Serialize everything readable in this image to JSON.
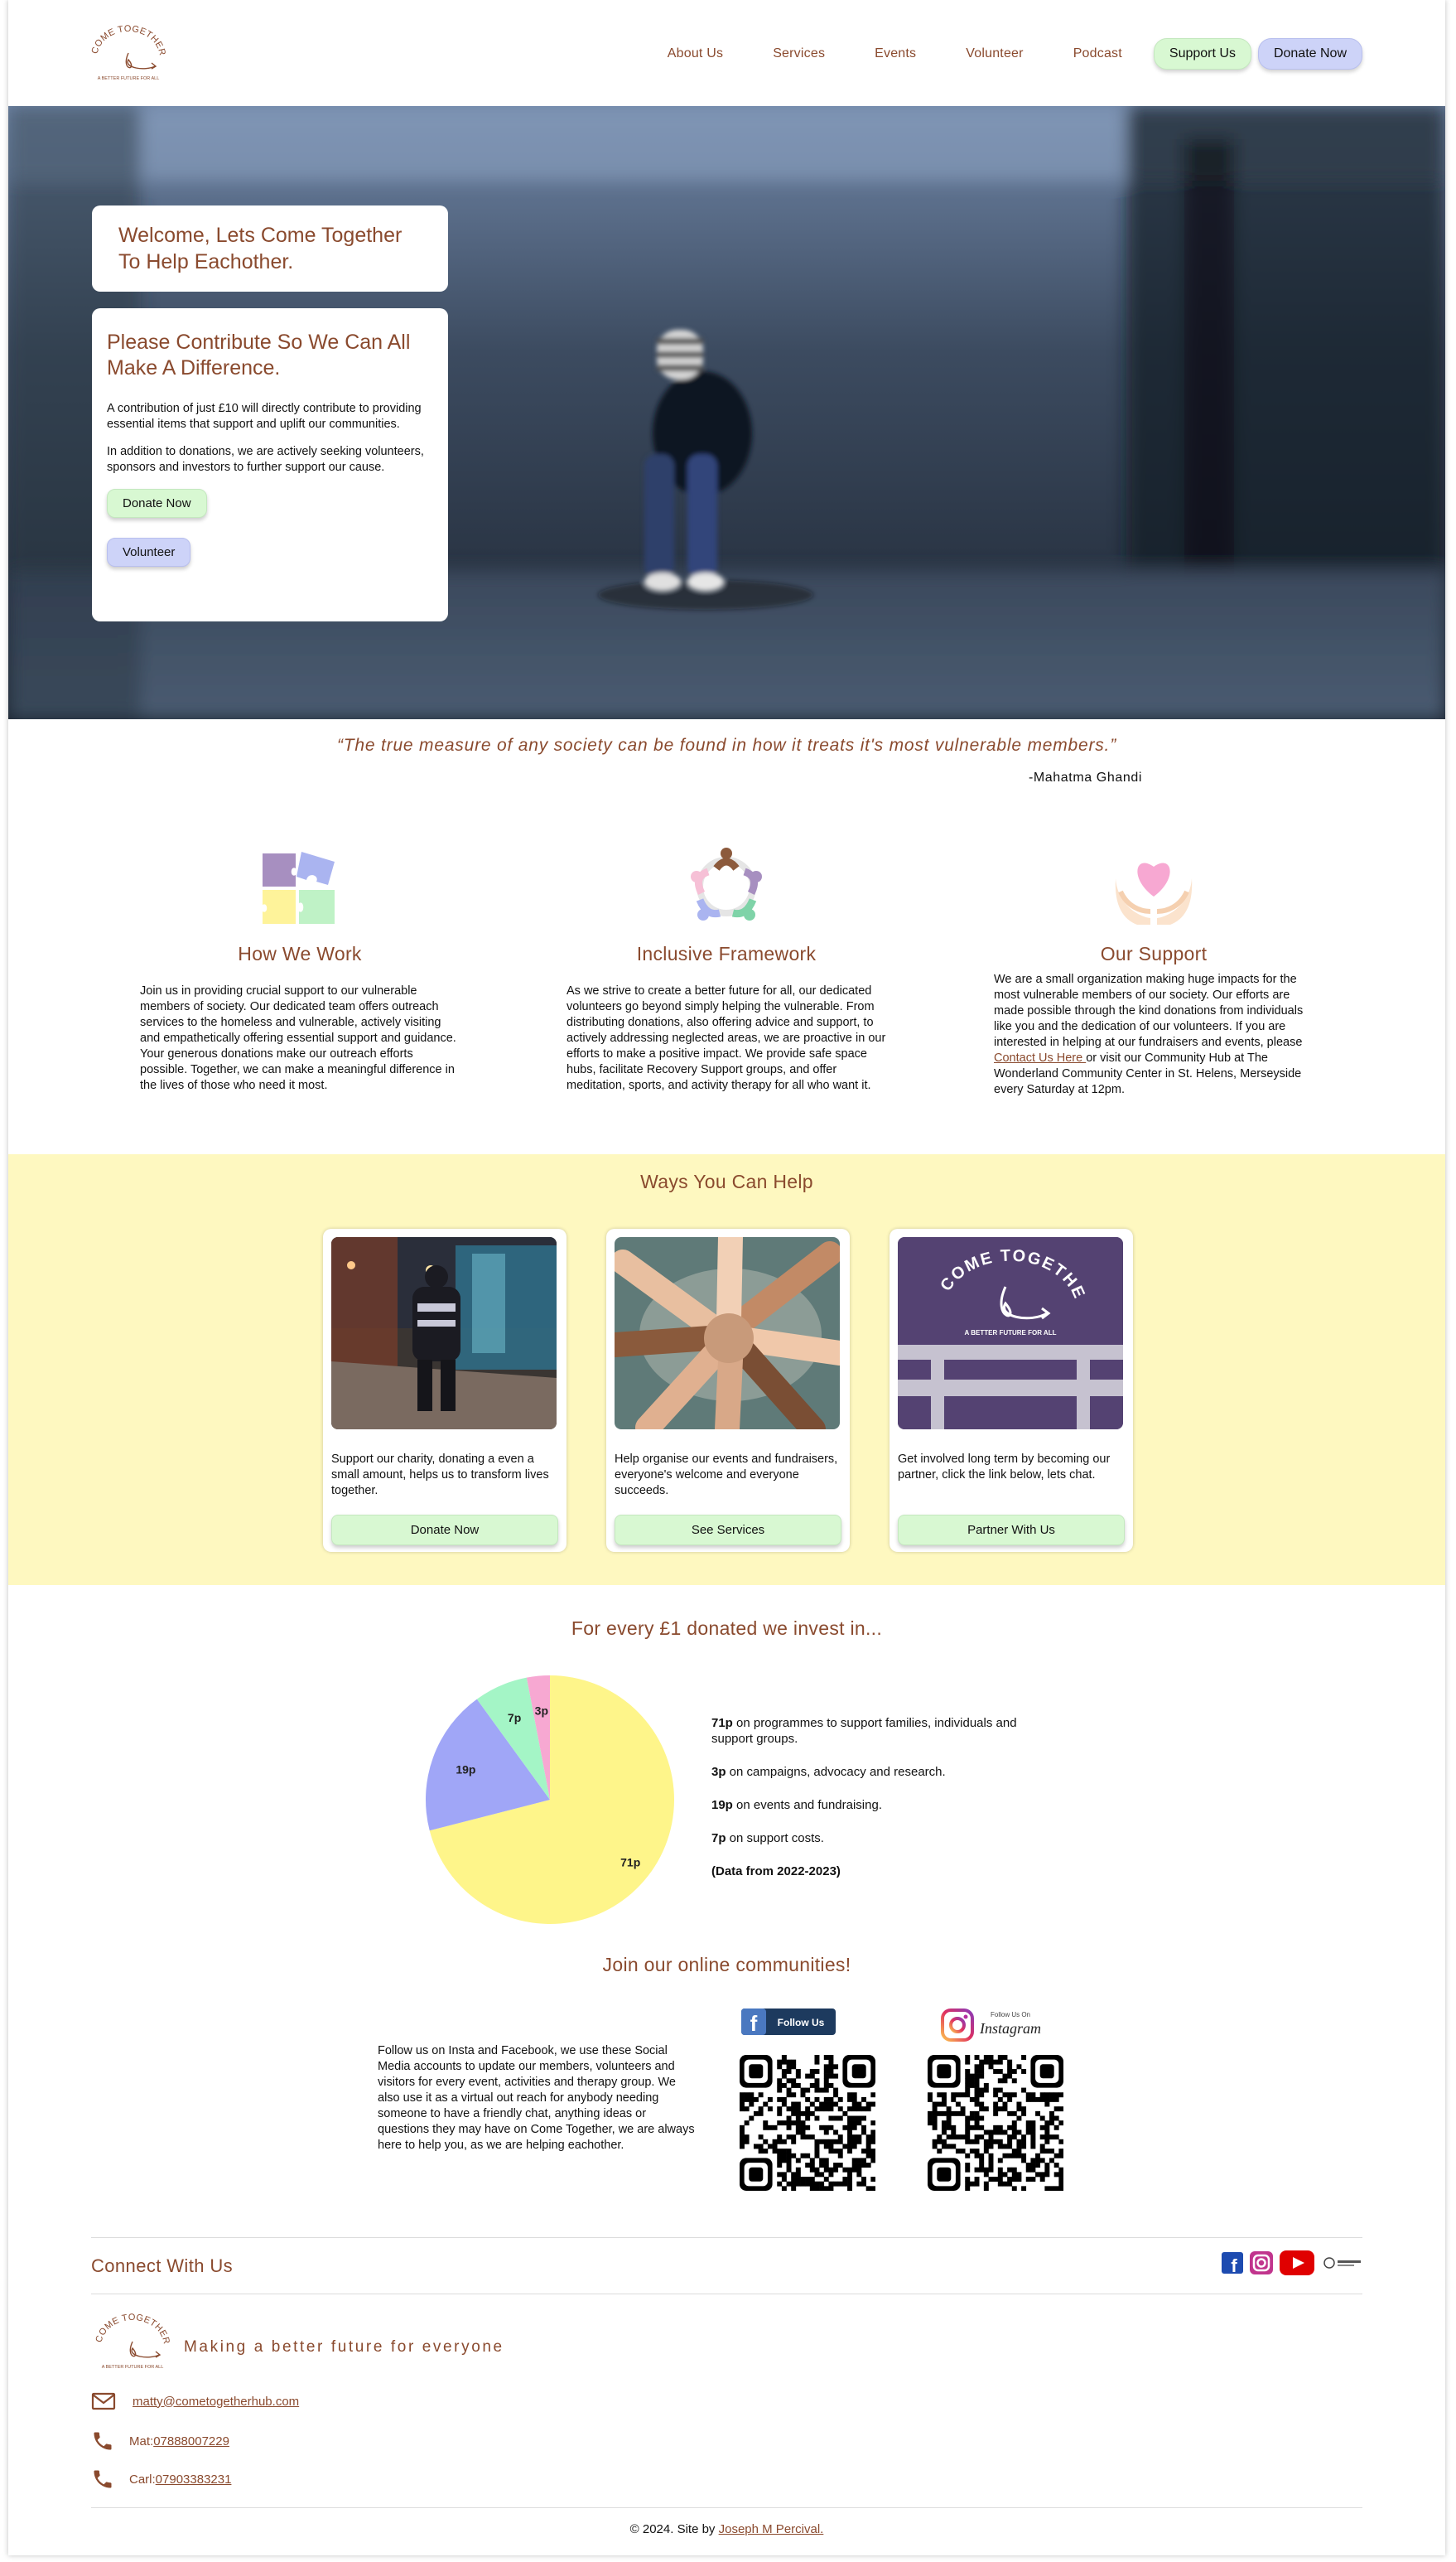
{
  "brand": {
    "logo_text": "COME TOGETHER",
    "logo_sub": "A BETTER FUTURE FOR ALL"
  },
  "nav": {
    "items": [
      "About Us",
      "Services",
      "Events",
      "Volunteer",
      "Podcast"
    ],
    "support": "Support Us",
    "donate": "Donate Now"
  },
  "hero": {
    "welcome": "Welcome, Lets Come Together To Help Eachother.",
    "contribute_title": "Please Contribute So We Can All Make A Difference.",
    "p1": "A contribution of just £10 will directly contribute to providing essential items that support and uplift our communities.",
    "p2": "In addition to donations, we are actively seeking volunteers, sponsors and investors to further support our cause.",
    "donate_btn": "Donate Now",
    "volunteer_btn": "Volunteer"
  },
  "quote": {
    "text": "“The true measure of any society can be found in how it treats it's most vulnerable members.”",
    "author": "-Mahatma Ghandi"
  },
  "features": [
    {
      "icon": "puzzle-icon",
      "title": "How We Work",
      "text": "Join us in providing crucial support to our vulnerable members of society. Our dedicated team offers outreach services to the homeless and vulnerable, actively visiting and empathetically offering essential support and guidance. Your generous donations make our outreach efforts possible. Together, we can make a meaningful difference in the lives of those who need it most."
    },
    {
      "icon": "people-circle-icon",
      "title": "Inclusive Framework",
      "text": "As we strive to create a better future for all, our dedicated volunteers go beyond simply helping the vulnerable. From distributing donations, also offering advice and support, to actively addressing neglected areas, we are proactive in our efforts to make a positive impact. We provide safe space hubs, facilitate Recovery Support groups, and offer meditation, sports, and activity therapy for all who want it."
    },
    {
      "icon": "heart-hands-icon",
      "title": "Our Support",
      "text_before": "We are a small organization making huge impacts for the most vulnerable members of our society. Our efforts are made possible through the kind donations from individuals like you and the dedication of our volunteers. If you are interested in helping at our fundraisers and events, please ",
      "link": "Contact Us Here ",
      "text_after": "or visit our Community Hub at The Wonderland Community Center in St. Helens, Merseyside every Saturday at 12pm."
    }
  ],
  "ways": {
    "title": "Ways You Can Help",
    "cards": [
      {
        "text": "Support our charity, donating a even a small amount, helps us to transform lives together.",
        "button": "Donate Now"
      },
      {
        "text": "Help organise our events and fundraisers, everyone's welcome and everyone succeeds.",
        "button": "See Services"
      },
      {
        "text": "Get involved long term by becoming our partner, click the link below, lets chat.",
        "button": "Partner With Us"
      }
    ],
    "vest_text": "COME TOGETHER",
    "vest_sub": "A BETTER FUTURE FOR ALL"
  },
  "donation": {
    "title": "For every £1 donated we invest in...",
    "legend": [
      {
        "bold": "71p",
        "text": " on programmes to support families, individuals and support groups."
      },
      {
        "bold": "3p",
        "text": " on campaigns, advocacy and research."
      },
      {
        "bold": "19p",
        "text": " on events and fundraising."
      },
      {
        "bold": "7p",
        "text": " on support costs."
      }
    ],
    "note": "(Data from 2022-2023)"
  },
  "chart_data": {
    "type": "pie",
    "categories": [
      "programmes",
      "events and fundraising",
      "support costs",
      "campaigns, advocacy and research"
    ],
    "values": [
      71,
      19,
      7,
      3
    ],
    "labels": [
      "71p",
      "19p",
      "7p",
      "3p"
    ],
    "colors": [
      "#fef58a",
      "#a0a6f7",
      "#a4f5c6",
      "#f7a8d2"
    ]
  },
  "communities": {
    "title": "Join our online communities!",
    "text": "Follow us on Insta and Facebook, we use these Social Media accounts to update our members, volunteers and visitors for every event, activities and therapy group. We also use it as a virtual out reach for anybody needing someone to have a friendly chat, anything ideas or questions they may have on Come Together, we are always here to help you, as we are helping eachother.",
    "facebook_btn": "Follow Us",
    "insta_small": "Follow Us On",
    "insta_name": "Instagram"
  },
  "footer": {
    "connect": "Connect With Us",
    "tagline": "Making a better future for everyone",
    "email": "matty@cometogetherhub.com",
    "phone1_label": "Mat: ",
    "phone1": "07888007229",
    "phone2_label": "Carl: ",
    "phone2": "07903383231",
    "copyright": "© 2024. Site by ",
    "author": "Joseph M Percival."
  }
}
